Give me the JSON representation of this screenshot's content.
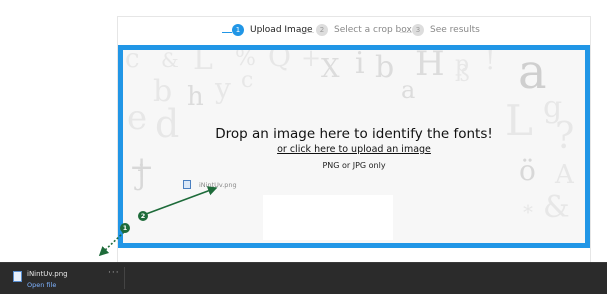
{
  "steps": [
    {
      "num": "1",
      "label": "Upload Image",
      "active": true
    },
    {
      "num": "2",
      "label": "Select a crop box",
      "active": false
    },
    {
      "num": "3",
      "label": "See results",
      "active": false
    }
  ],
  "dropzone": {
    "title": "Drop an image here to identify the fonts!",
    "upload_link": "or click here to upload an image",
    "format_note": "PNG or JPG only",
    "dragged_file_label": "iNintUv.png"
  },
  "annotations": {
    "badge_1": "1",
    "badge_2": "2"
  },
  "download_bar": {
    "file_name": "iNintUv.png",
    "open_label": "Open file",
    "more_label": "···"
  },
  "colors": {
    "accent": "#2196e6",
    "arrow": "#1e6b3a",
    "download_bar_bg": "#2b2b2b"
  }
}
